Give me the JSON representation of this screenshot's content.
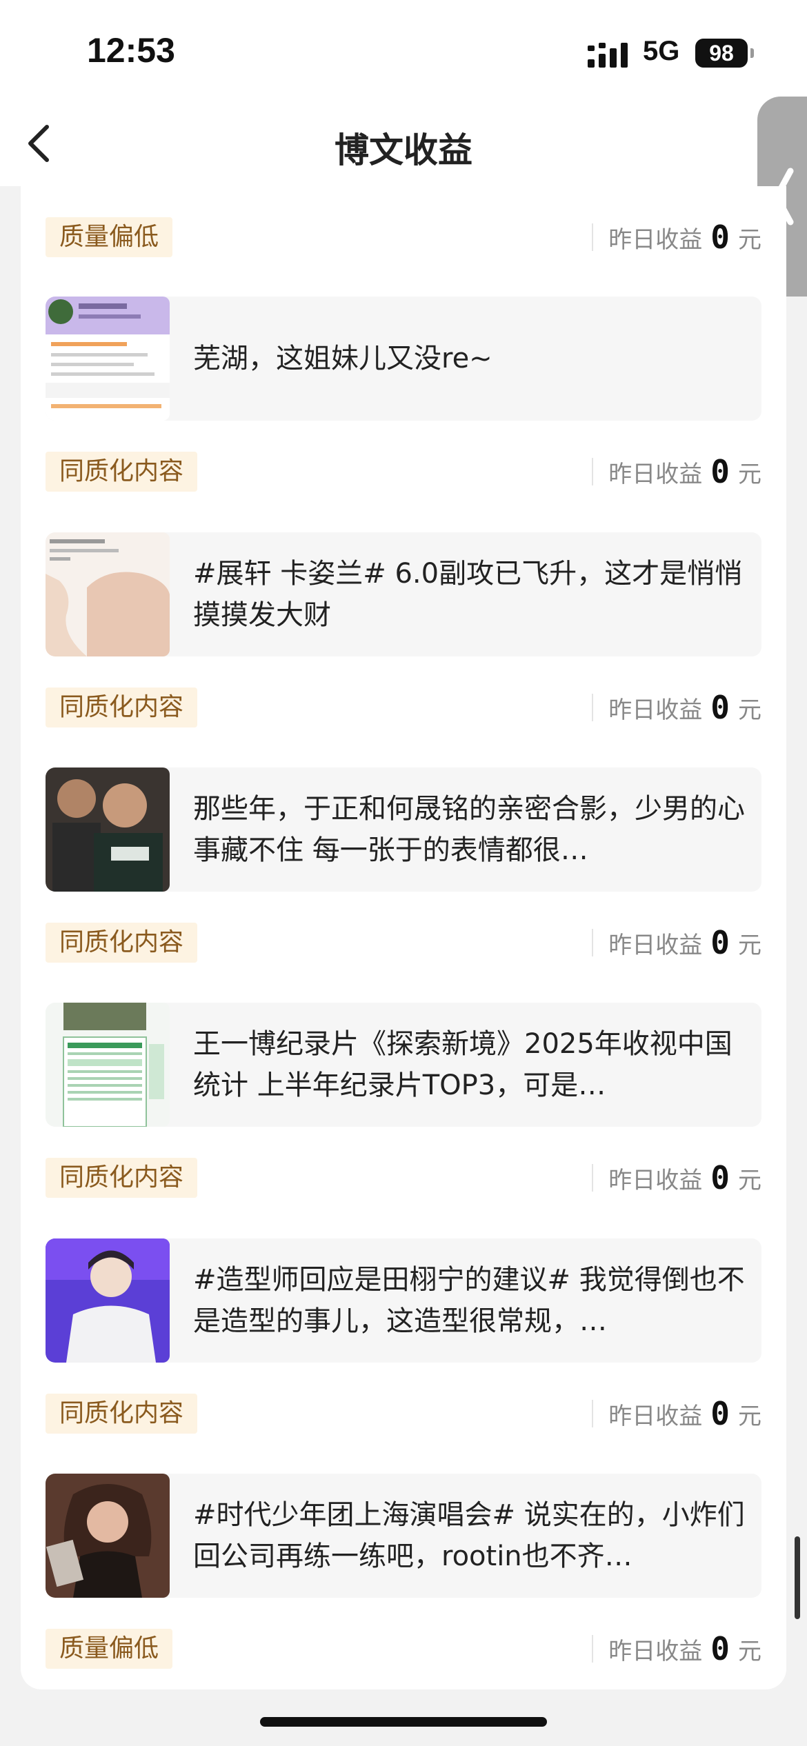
{
  "status_bar": {
    "time": "12:53",
    "network": "5G",
    "battery": "98"
  },
  "nav": {
    "title": "博文收益"
  },
  "earnings": {
    "label": "昨日收益",
    "value": "0",
    "unit": "元"
  },
  "sections": [
    {
      "tag": "质量偏低"
    },
    {
      "post": "芜湖，这姐妹儿又没re~",
      "tag": "同质化内容"
    },
    {
      "post": "#展轩 卡姿兰# 6.0副攻已飞升，这才是悄悄摸摸发大财",
      "tag": "同质化内容"
    },
    {
      "post": "那些年，于正和何晟铭的亲密合影，少男的心事藏不住 每一张于的表情都很…",
      "tag": "同质化内容"
    },
    {
      "post": "王一博纪录片《探索新境》2025年收视中国统计 上半年纪录片TOP3，可是…",
      "tag": "同质化内容"
    },
    {
      "post": "#造型师回应是田栩宁的建议# 我觉得倒也不是造型的事儿，这造型很常规，…",
      "tag": "同质化内容"
    },
    {
      "post": "#时代少年团上海演唱会# 说实在的，小炸们回公司再练一练吧，rootin也不齐…",
      "tag": "质量偏低"
    }
  ]
}
